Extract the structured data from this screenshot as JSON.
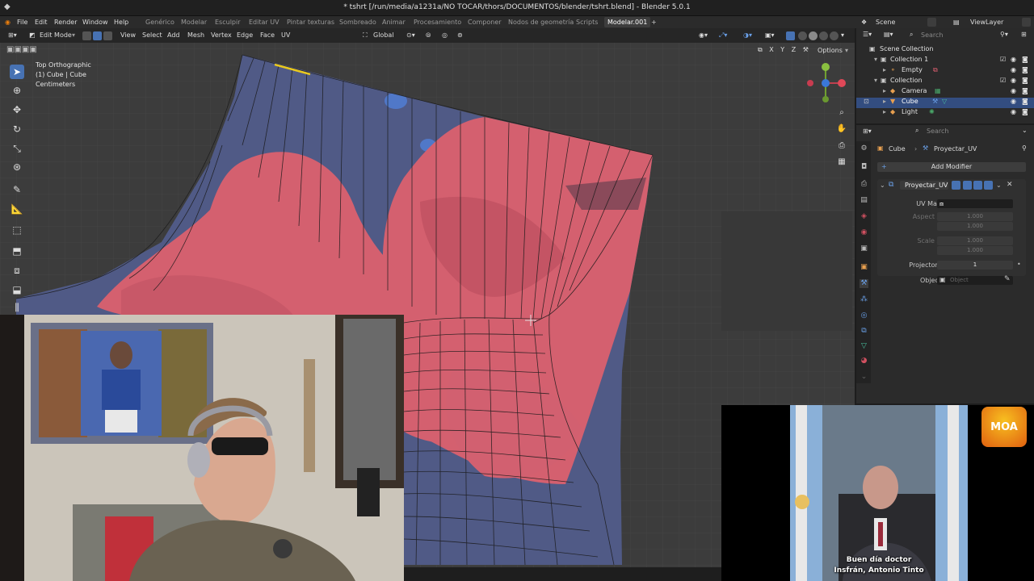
{
  "window": {
    "title": "* tshrt [/run/media/a1231a/NO TOCAR/thors/DOCUMENTOS/blender/tshrt.blend] - Blender 5.0.1"
  },
  "menu": {
    "items": [
      "File",
      "Edit",
      "Render",
      "Window",
      "Help"
    ]
  },
  "workspaces": [
    "Genérico",
    "Modelar",
    "Esculpir",
    "Editar UV",
    "Pintar texturas",
    "Sombreado",
    "Animar",
    "Procesamiento",
    "Componer",
    "Nodos de geometría",
    "Scripts",
    "Modelar.001"
  ],
  "topright": {
    "scene": "Scene",
    "viewlayer": "ViewLayer"
  },
  "vp_header": {
    "mode": "Edit Mode",
    "menus": [
      "View",
      "Select",
      "Add",
      "Mesh",
      "Vertex",
      "Edge",
      "Face",
      "UV"
    ],
    "orientation": "Global",
    "options": "Options"
  },
  "vp_info": {
    "view": "Top Orthographic",
    "object": "(1) Cube | Cube",
    "units": "Centimeters"
  },
  "axes": {
    "x": "X",
    "y": "Y",
    "z": "Z"
  },
  "outliner": {
    "search_placeholder": "Search",
    "rows": [
      {
        "label": "Scene Collection"
      },
      {
        "label": "Collection 1"
      },
      {
        "label": "Empty"
      },
      {
        "label": "Collection"
      },
      {
        "label": "Camera"
      },
      {
        "label": "Cube"
      },
      {
        "label": "Light"
      }
    ]
  },
  "properties": {
    "search_placeholder": "Search",
    "breadcrumb_object": "Cube",
    "breadcrumb_modifier": "Proyectar_UV",
    "add_modifier": "Add Modifier",
    "modifier_name": "Proyectar_UV",
    "uv_map_label": "UV Map",
    "aspect_x_label": "Aspect X",
    "aspect_x": "1.000",
    "aspect_y_label": "Y",
    "aspect_y": "1.000",
    "scale_x_label": "Scale X",
    "scale_x": "1.000",
    "scale_y_label": "Y",
    "scale_y": "1.000",
    "projectors_label": "Projectors",
    "projectors": "1",
    "object_label": "Object",
    "object_placeholder": "Object"
  },
  "overlay": {
    "caption_line1": "Buen día doctor",
    "caption_line2": "Insfrán, Antonio Tinto",
    "logo_text": "MOA"
  },
  "colors": {
    "accent": "#4772b3",
    "flower": "#d4606f",
    "bg_texture": "#4a5a88"
  }
}
